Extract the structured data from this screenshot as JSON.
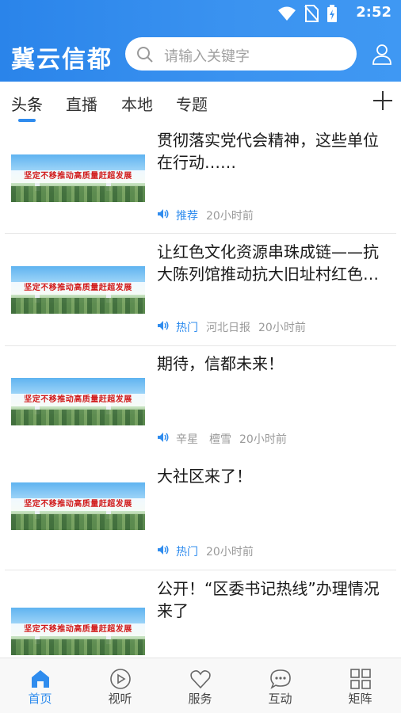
{
  "status_bar": {
    "time": "2:52"
  },
  "header": {
    "app_title": "冀云信都",
    "search_placeholder": "请输入关键字"
  },
  "tabs": [
    {
      "label": "头条",
      "active": true
    },
    {
      "label": "直播"
    },
    {
      "label": "本地"
    },
    {
      "label": "专题"
    }
  ],
  "feed": [
    {
      "title": "贯彻落实党代会精神，这些单位在行动……",
      "tag": "推荐",
      "source": "",
      "time": "20小时前",
      "thumb_text": "坚定不移推动高质量赶超发展"
    },
    {
      "title": "让红色文化资源串珠成链——抗大陈列馆推动抗大旧址村红色…",
      "tag": "热门",
      "source": "河北日报",
      "time": "20小时前",
      "thumb_text": "坚定不移推动高质量赶超发展"
    },
    {
      "title": "期待，信都未来！",
      "tag": "",
      "source": "辛星　檀雪",
      "time": "20小时前",
      "thumb_text": "坚定不移推动高质量赶超发展"
    },
    {
      "title": "大社区来了！",
      "tag": "热门",
      "source": "",
      "time": "20小时前",
      "thumb_text": "坚定不移推动高质量赶超发展"
    },
    {
      "title": "公开！“区委书记热线”办理情况来了",
      "tag": "",
      "source": "",
      "time": "",
      "thumb_text": "坚定不移推动高质量赶超发展"
    }
  ],
  "bottom_nav": [
    {
      "label": "首页",
      "icon": "home-icon",
      "active": true
    },
    {
      "label": "视听",
      "icon": "play-icon"
    },
    {
      "label": "服务",
      "icon": "heart-icon"
    },
    {
      "label": "互动",
      "icon": "chat-icon"
    },
    {
      "label": "矩阵",
      "icon": "grid-icon"
    }
  ],
  "colors": {
    "accent": "#2f8cee",
    "header_start": "#2a84ea",
    "header_end": "#3f98f3"
  }
}
